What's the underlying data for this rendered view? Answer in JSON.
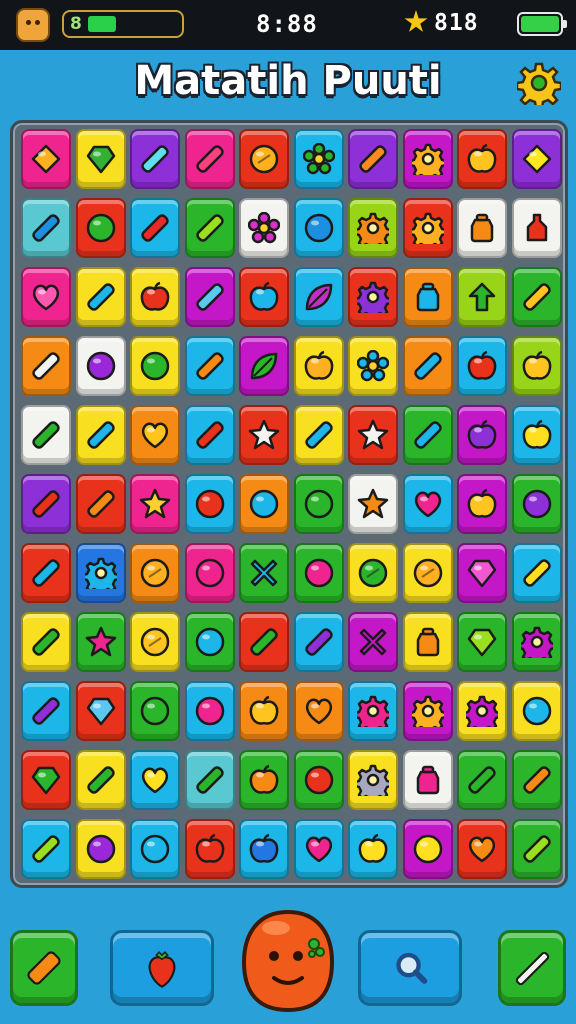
{
  "status_bar": {
    "left_value": "8",
    "time": "8:88",
    "right_value": "818",
    "right_icons": [
      "star-icon",
      "bluetooth-icon",
      "signal-icon",
      "battery-icon"
    ]
  },
  "title": "Matatih Puuti",
  "settings_icon": "gear-icon",
  "colors": {
    "pink": "#f0248e",
    "yellow": "#f8e020",
    "purple": "#8e30d8",
    "red": "#e8321c",
    "cyan": "#1cb6e8",
    "orange": "#f58a14",
    "green": "#2ab52a",
    "lime": "#98d418",
    "white": "#f3f3f0",
    "magenta": "#c418c8",
    "teal": "#5ac8d0",
    "blue": "#2476e0"
  },
  "board": {
    "rows": [
      [
        [
          "pink",
          "diamond",
          "#ffb020"
        ],
        [
          "yellow",
          "gem",
          "#34b034"
        ],
        [
          "purple",
          "bar",
          "#5ee0f0"
        ],
        [
          "pink",
          "bar",
          "#ff4080"
        ],
        [
          "red",
          "coin",
          "#ffb01c"
        ],
        [
          "cyan",
          "flower",
          "#2ab52a"
        ],
        [
          "purple",
          "bar",
          "#ff8a20"
        ],
        [
          "magenta",
          "gear",
          "#ffb020"
        ],
        [
          "red",
          "apple",
          "#ffc420"
        ],
        [
          "purple",
          "diamond",
          "#ffe820"
        ]
      ],
      [
        [
          "teal",
          "bar",
          "#1c8fe0"
        ],
        [
          "red",
          "circle",
          "#2ab52a"
        ],
        [
          "cyan",
          "bar",
          "#e82a2a"
        ],
        [
          "green",
          "bar",
          "#98e020"
        ],
        [
          "white",
          "flower",
          "#d830c8"
        ],
        [
          "cyan",
          "circle",
          "#1c8fe0"
        ],
        [
          "lime",
          "gear",
          "#f58a14"
        ],
        [
          "red",
          "gear",
          "#ffb020"
        ],
        [
          "white",
          "pot",
          "#f58a14"
        ],
        [
          "white",
          "bottle",
          "#e8321c"
        ]
      ],
      [
        [
          "pink",
          "heart",
          "#ff58b0"
        ],
        [
          "yellow",
          "bar",
          "#1cb6e8"
        ],
        [
          "yellow",
          "apple",
          "#e8321c"
        ],
        [
          "magenta",
          "bar",
          "#5ac8f0"
        ],
        [
          "red",
          "apple",
          "#1cb6e8"
        ],
        [
          "cyan",
          "leaf",
          "#c030c8"
        ],
        [
          "red",
          "gear",
          "#8e30d8"
        ],
        [
          "orange",
          "pot",
          "#1cb6e8"
        ],
        [
          "lime",
          "arrow",
          "#2ab52a"
        ],
        [
          "green",
          "bar",
          "#ffc420"
        ]
      ],
      [
        [
          "orange",
          "bar",
          "#f3f3f0"
        ],
        [
          "white",
          "circle",
          "#9a28d8"
        ],
        [
          "yellow",
          "circle",
          "#2ab52a"
        ],
        [
          "cyan",
          "bar",
          "#f58a14"
        ],
        [
          "magenta",
          "leaf",
          "#2ab52a"
        ],
        [
          "yellow",
          "apple",
          "#ffb020"
        ],
        [
          "yellow",
          "flower",
          "#1cb6e8"
        ],
        [
          "orange",
          "bar",
          "#1cb6e8"
        ],
        [
          "cyan",
          "apple",
          "#e8321c"
        ],
        [
          "lime",
          "apple",
          "#ffc420"
        ]
      ],
      [
        [
          "white",
          "bar",
          "#2ab52a"
        ],
        [
          "yellow",
          "bar",
          "#1cb6e8"
        ],
        [
          "orange",
          "heart",
          "#ffc420"
        ],
        [
          "cyan",
          "bar",
          "#e8321c"
        ],
        [
          "red",
          "star",
          "#f3f3f0"
        ],
        [
          "yellow",
          "bar",
          "#1cb6e8"
        ],
        [
          "red",
          "star",
          "#f3f3f0"
        ],
        [
          "green",
          "bar",
          "#1cb6e8"
        ],
        [
          "magenta",
          "apple",
          "#8e30d8"
        ],
        [
          "cyan",
          "apple",
          "#ffe020"
        ]
      ],
      [
        [
          "purple",
          "bar",
          "#e8321c"
        ],
        [
          "red",
          "bar",
          "#f58a14"
        ],
        [
          "pink",
          "star",
          "#ffd030"
        ],
        [
          "cyan",
          "circle",
          "#e8321c"
        ],
        [
          "orange",
          "circle",
          "#1cb6e8"
        ],
        [
          "green",
          "circle",
          "#2ab52a"
        ],
        [
          "white",
          "star",
          "#f58a14"
        ],
        [
          "cyan",
          "heart",
          "#f0248e"
        ],
        [
          "magenta",
          "apple",
          "#ffc420"
        ],
        [
          "green",
          "circle",
          "#8e30d8"
        ]
      ],
      [
        [
          "red",
          "bar",
          "#1cb6e8"
        ],
        [
          "blue",
          "gear",
          "#1cb6e8"
        ],
        [
          "orange",
          "coin",
          "#ffb020"
        ],
        [
          "pink",
          "circle",
          "#f0248e"
        ],
        [
          "green",
          "cross",
          "#1cb6e8"
        ],
        [
          "green",
          "circle",
          "#f0248e"
        ],
        [
          "yellow",
          "coin",
          "#2ab52a"
        ],
        [
          "yellow",
          "coin",
          "#ffb020"
        ],
        [
          "magenta",
          "gem",
          "#f058d0"
        ],
        [
          "cyan",
          "bar",
          "#ffe020"
        ]
      ],
      [
        [
          "yellow",
          "bar",
          "#2ab52a"
        ],
        [
          "green",
          "star",
          "#f0248e"
        ],
        [
          "yellow",
          "coin",
          "#ffc420"
        ],
        [
          "green",
          "circle",
          "#1cb6e8"
        ],
        [
          "red",
          "bar",
          "#2ab52a"
        ],
        [
          "cyan",
          "bar",
          "#8e30d8"
        ],
        [
          "magenta",
          "cross",
          "#c418c8"
        ],
        [
          "yellow",
          "pot",
          "#f58a14"
        ],
        [
          "green",
          "gem",
          "#98e020"
        ],
        [
          "green",
          "gear",
          "#c418c8"
        ]
      ],
      [
        [
          "cyan",
          "bar",
          "#8e30d8"
        ],
        [
          "red",
          "gem",
          "#5ac8f0"
        ],
        [
          "green",
          "circle",
          "#2ab52a"
        ],
        [
          "cyan",
          "circle",
          "#f0248e"
        ],
        [
          "orange",
          "apple",
          "#ffc420"
        ],
        [
          "orange",
          "heart",
          "#f58a14"
        ],
        [
          "cyan",
          "gear",
          "#f0248e"
        ],
        [
          "magenta",
          "gear",
          "#ffb020"
        ],
        [
          "yellow",
          "gear",
          "#c418c8"
        ],
        [
          "yellow",
          "circle",
          "#1cb6e8"
        ]
      ],
      [
        [
          "red",
          "gem",
          "#2ab52a"
        ],
        [
          "yellow",
          "bar",
          "#2ab52a"
        ],
        [
          "cyan",
          "heart",
          "#ffe020"
        ],
        [
          "teal",
          "bar",
          "#2ab52a"
        ],
        [
          "green",
          "apple",
          "#f58a14"
        ],
        [
          "green",
          "circle",
          "#e8321c"
        ],
        [
          "yellow",
          "gear",
          "#a8a8c0"
        ],
        [
          "white",
          "pot",
          "#f0248e"
        ],
        [
          "green",
          "bar",
          "#2ab52a"
        ],
        [
          "green",
          "bar",
          "#f58a14"
        ]
      ],
      [
        [
          "cyan",
          "bar",
          "#98e020"
        ],
        [
          "yellow",
          "circle",
          "#9a28d8"
        ],
        [
          "cyan",
          "circle",
          "#1cb6e8"
        ],
        [
          "red",
          "apple",
          "#e8321c"
        ],
        [
          "cyan",
          "apple",
          "#2476e0"
        ],
        [
          "cyan",
          "heart",
          "#f0248e"
        ],
        [
          "cyan",
          "apple",
          "#ffe020"
        ],
        [
          "magenta",
          "circle",
          "#ffe020"
        ],
        [
          "red",
          "heart",
          "#f58a14"
        ],
        [
          "green",
          "bar",
          "#98e020"
        ]
      ]
    ]
  },
  "bottom_bar": {
    "buttons": [
      {
        "name": "eraser-button",
        "icon": "eraser-icon",
        "bg": "#2ab52a",
        "fg": "#f58a14"
      },
      {
        "name": "strawberry-button",
        "icon": "strawberry-icon",
        "bg": "#1c9ee0",
        "fg": "#e8321c"
      },
      {
        "name": "search-button",
        "icon": "magnifier-icon",
        "bg": "#1c9ee0",
        "fg": "#1e4e8a"
      },
      {
        "name": "wand-button",
        "icon": "wand-icon",
        "bg": "#2ab52a",
        "fg": "#f3f3f0"
      }
    ],
    "mascot_icon": "blob-mascot-icon"
  }
}
